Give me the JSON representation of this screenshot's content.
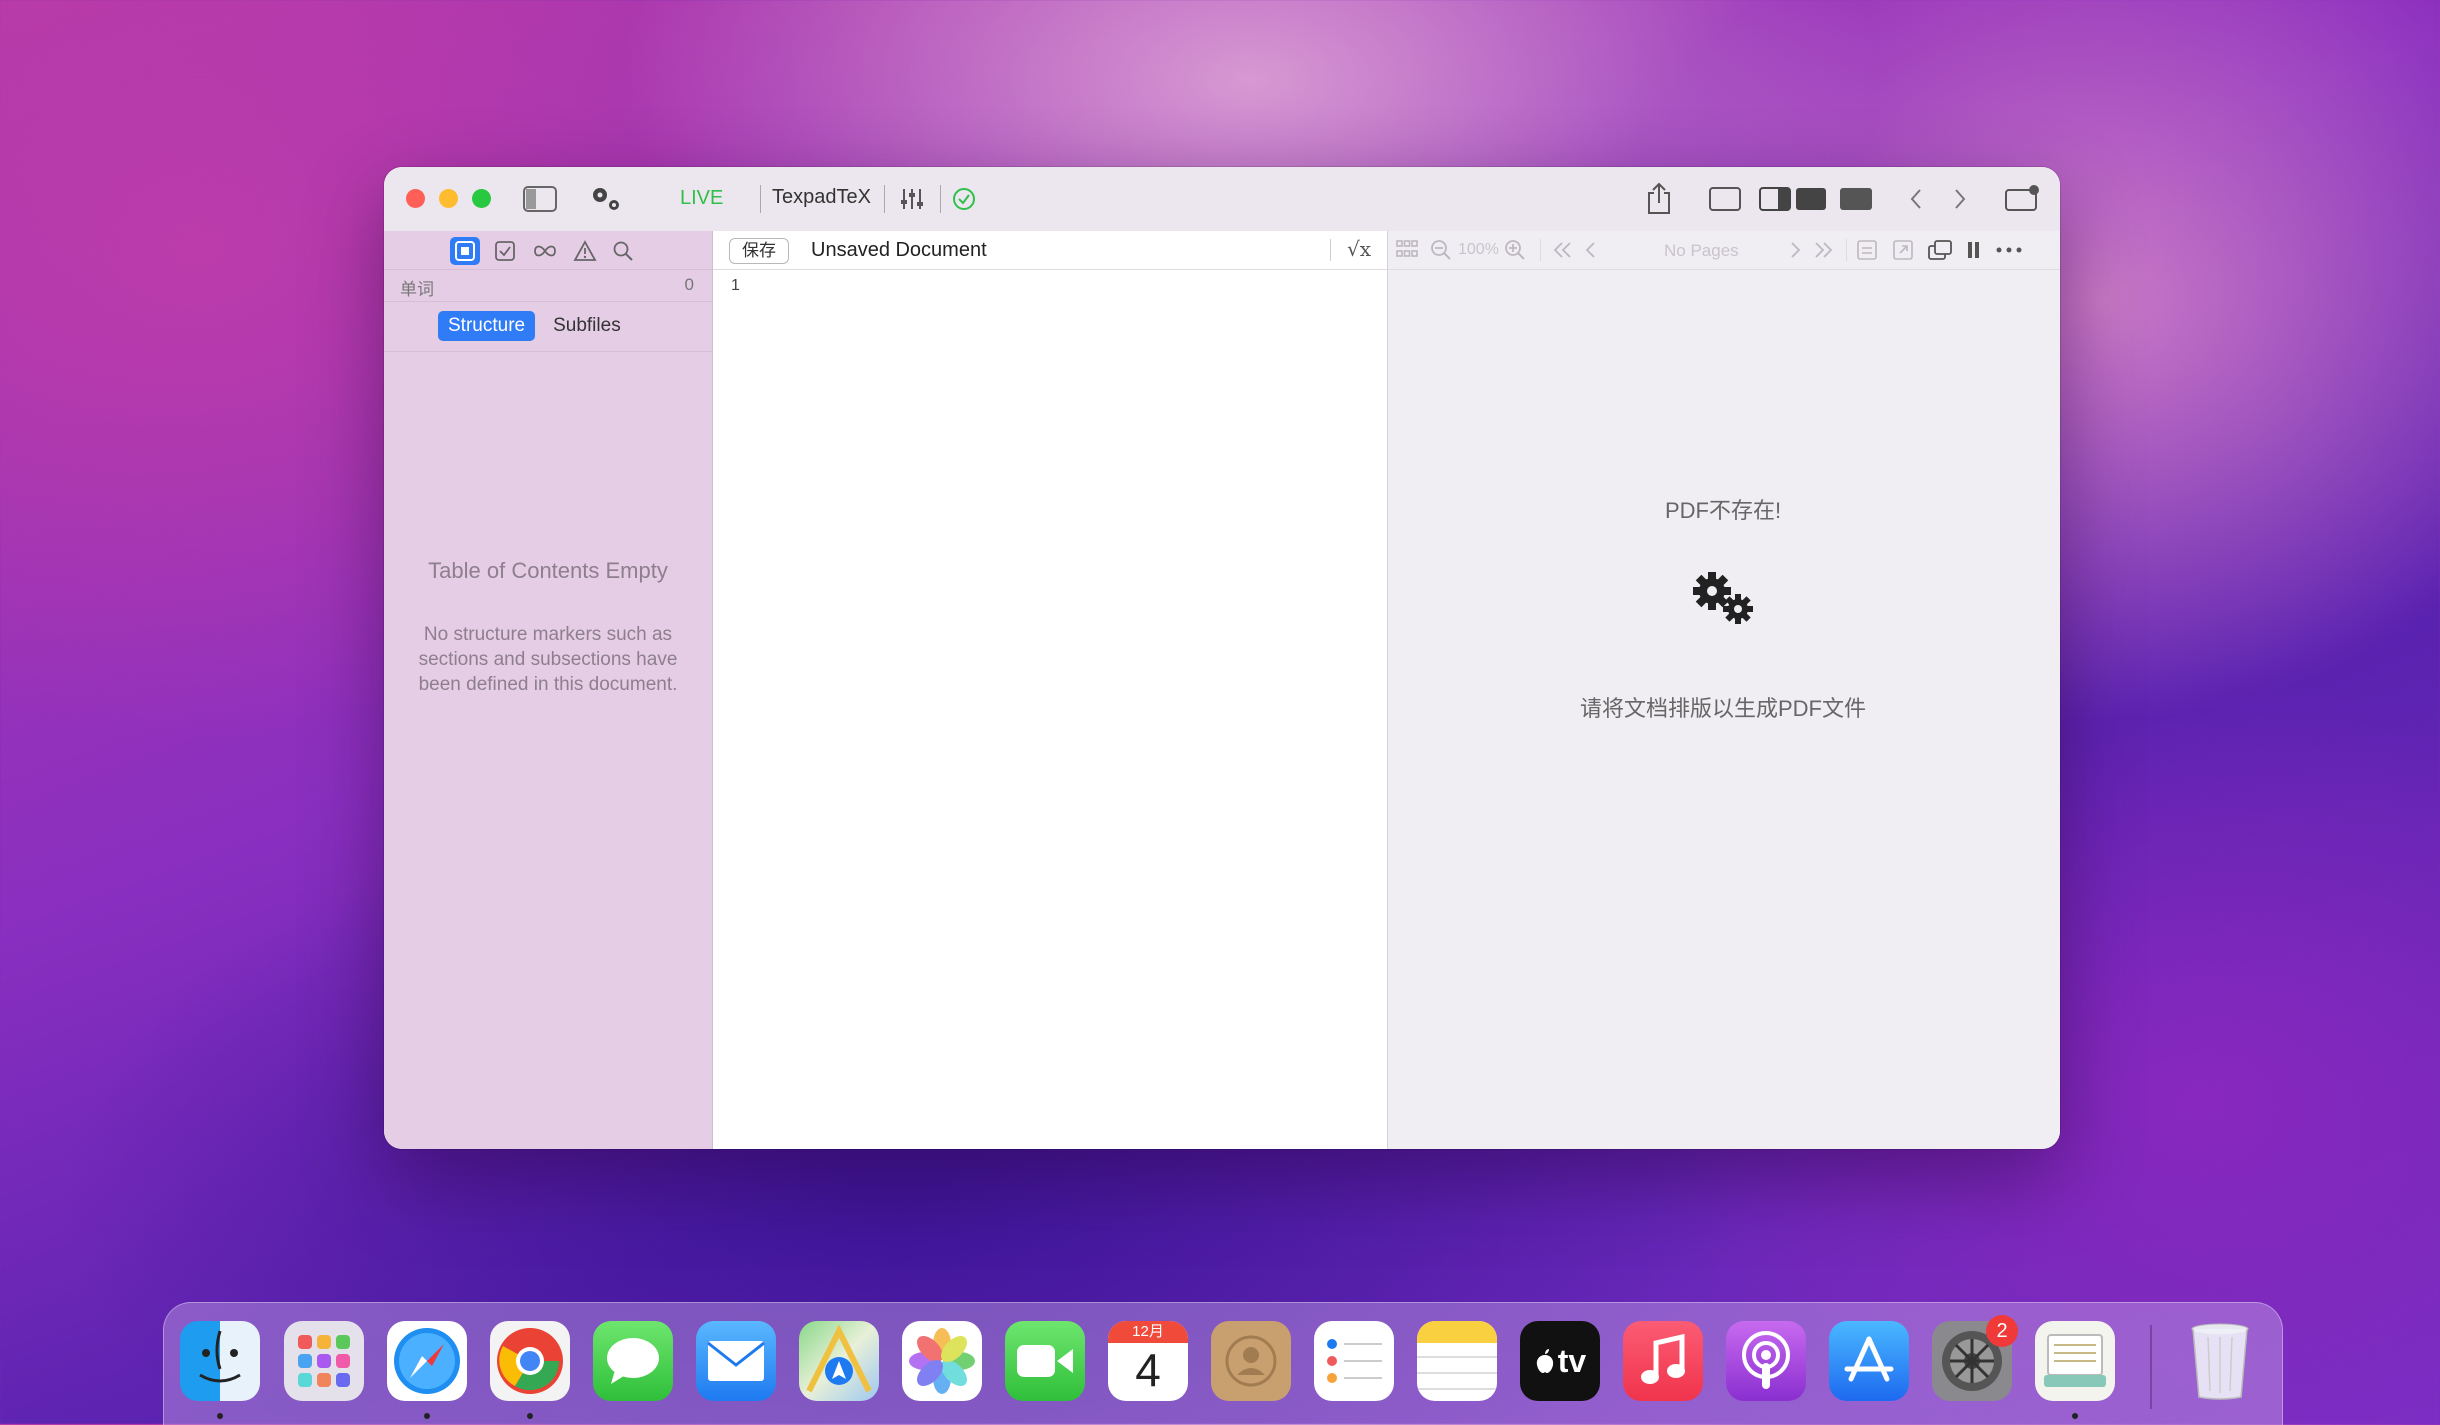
{
  "toolbar": {
    "live_label": "LIVE",
    "app_name": "TexpadTeX"
  },
  "sidebar": {
    "words_label": "单词",
    "words_count": "0",
    "tabs": [
      {
        "label": "Structure",
        "active": true
      },
      {
        "label": "Subfiles",
        "active": false
      }
    ],
    "toc_title": "Table of Contents Empty",
    "toc_description": "No structure markers such as sections and subsections have been defined in this document."
  },
  "editor": {
    "save_label": "保存",
    "document_title": "Unsaved Document",
    "sqrt_label": "√x",
    "line_numbers": [
      "1"
    ]
  },
  "preview": {
    "zoom_level": "100%",
    "pages_label": "No Pages",
    "pdf_missing": "PDF不存在!",
    "hint": "请将文档排版以生成PDF文件"
  },
  "dock": {
    "calendar_month": "12月",
    "calendar_day": "4",
    "tv_label": "tv",
    "settings_badge": "2",
    "apps": [
      "finder-icon",
      "launchpad-icon",
      "safari-icon",
      "chrome-icon",
      "messages-icon",
      "mail-icon",
      "maps-icon",
      "photos-icon",
      "facetime-icon",
      "calendar-icon",
      "contacts-icon",
      "reminders-icon",
      "notes-icon",
      "apple-tv-icon",
      "music-icon",
      "podcasts-icon",
      "app-store-icon",
      "system-preferences-icon",
      "texpad-icon",
      "trash-icon"
    ]
  },
  "colors": {
    "accent": "#2f7cf6",
    "live_green": "#2ec04a",
    "sidebar_bg": "#e6cde6",
    "close": "#fe5f57",
    "minimize": "#febc2e",
    "zoom": "#28c840"
  }
}
